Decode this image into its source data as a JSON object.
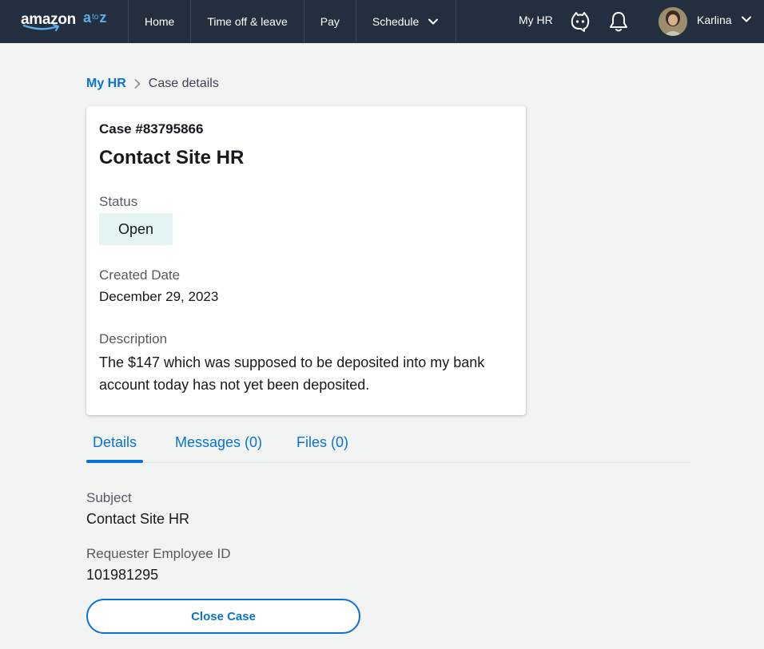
{
  "header": {
    "logo_word": "amazon",
    "logo_a": "a",
    "logo_to": "to",
    "logo_z": "z",
    "nav": [
      {
        "label": "Home"
      },
      {
        "label": "Time off & leave"
      },
      {
        "label": "Pay"
      },
      {
        "label": "Schedule"
      }
    ],
    "myhr_label": "My HR",
    "user_name": "Karlina",
    "icons": [
      "chatbot-icon",
      "bell-icon",
      "chevron-down-icon"
    ]
  },
  "breadcrumb": {
    "parent": "My HR",
    "current": "Case details"
  },
  "case": {
    "number": "Case #83795866",
    "title": "Contact Site HR",
    "status_label": "Status",
    "status_value": "Open",
    "created_label": "Created Date",
    "created_value": "December 29, 2023",
    "description_label": "Description",
    "description_value": "The $147 which was supposed to be deposited into my bank account today has not yet been deposited."
  },
  "tabs": [
    {
      "label": "Details",
      "active": true
    },
    {
      "label": "Messages (0)",
      "active": false
    },
    {
      "label": "Files (0)",
      "active": false
    }
  ],
  "details": {
    "subject_label": "Subject",
    "subject_value": "Contact Site HR",
    "requester_label": "Requester Employee ID",
    "requester_value": "101981295"
  },
  "actions": {
    "close_label": "Close Case"
  },
  "colors": {
    "header_bg": "#232f3e",
    "link_blue": "#0972d3",
    "status_bg": "#e3f4f3",
    "page_bg": "#f2f3f3"
  }
}
